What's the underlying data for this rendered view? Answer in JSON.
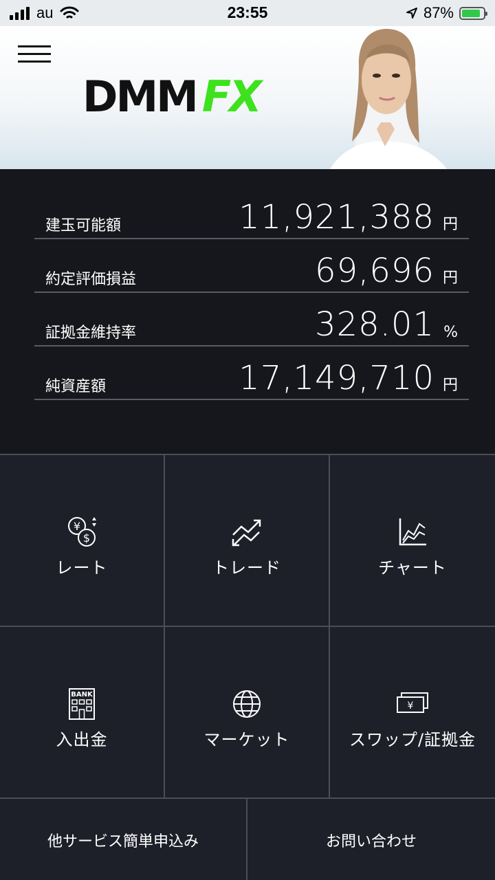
{
  "status_bar": {
    "carrier": "au",
    "time": "23:55",
    "battery_percent": "87%",
    "battery_level": 0.87,
    "icons": [
      "signal-icon",
      "wifi-icon",
      "location-icon",
      "battery-charging-icon"
    ]
  },
  "header": {
    "logo_part1": "DMM",
    "logo_part2": "FX",
    "brand_color": "#3ee11e",
    "menu_icon": "hamburger-menu-icon"
  },
  "summary": [
    {
      "label": "建玉可能額",
      "value": "11,921,388",
      "unit": "円"
    },
    {
      "label": "約定評価損益",
      "value": "69,696",
      "unit": "円"
    },
    {
      "label": "証拠金維持率",
      "value": "328.01",
      "unit": "%"
    },
    {
      "label": "純資産額",
      "value": "17,149,710",
      "unit": "円"
    }
  ],
  "menu": [
    {
      "label": "レート",
      "icon": "currency-exchange-icon"
    },
    {
      "label": "トレード",
      "icon": "trade-arrows-icon"
    },
    {
      "label": "チャート",
      "icon": "chart-icon"
    },
    {
      "label": "入出金",
      "icon": "bank-icon"
    },
    {
      "label": "マーケット",
      "icon": "globe-icon"
    },
    {
      "label": "スワップ/証拠金",
      "icon": "yen-notes-icon"
    }
  ],
  "bottom_buttons": {
    "left": "他サービス簡単申込み",
    "right": "お問い合わせ"
  }
}
